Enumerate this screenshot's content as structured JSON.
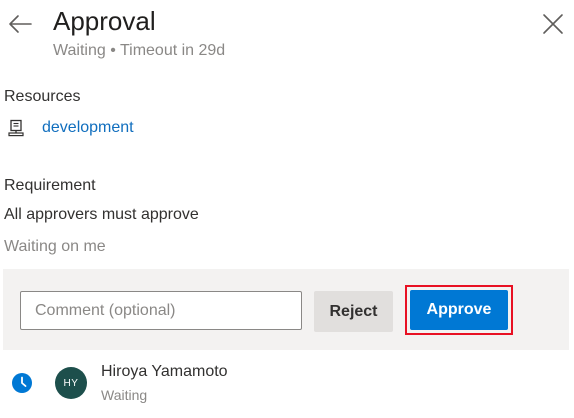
{
  "header": {
    "title": "Approval",
    "subtitle": "Waiting • Timeout in 29d",
    "back_icon": "arrow-left-icon",
    "close_icon": "close-icon"
  },
  "resources": {
    "label": "Resources",
    "items": [
      {
        "icon": "environment-icon",
        "name": "development"
      }
    ]
  },
  "requirement": {
    "label": "Requirement",
    "text": "All approvers must approve",
    "status": "Waiting on me"
  },
  "actions": {
    "comment_placeholder": "Comment (optional)",
    "comment_value": "",
    "reject_label": "Reject",
    "approve_label": "Approve"
  },
  "approvers": [
    {
      "initials": "HY",
      "name": "Hiroya Yamamoto",
      "status": "Waiting",
      "status_icon": "clock-icon"
    }
  ],
  "colors": {
    "accent": "#0078d4",
    "link": "#106ebe",
    "highlight": "#e81123",
    "avatar": "#1d4f4c"
  }
}
